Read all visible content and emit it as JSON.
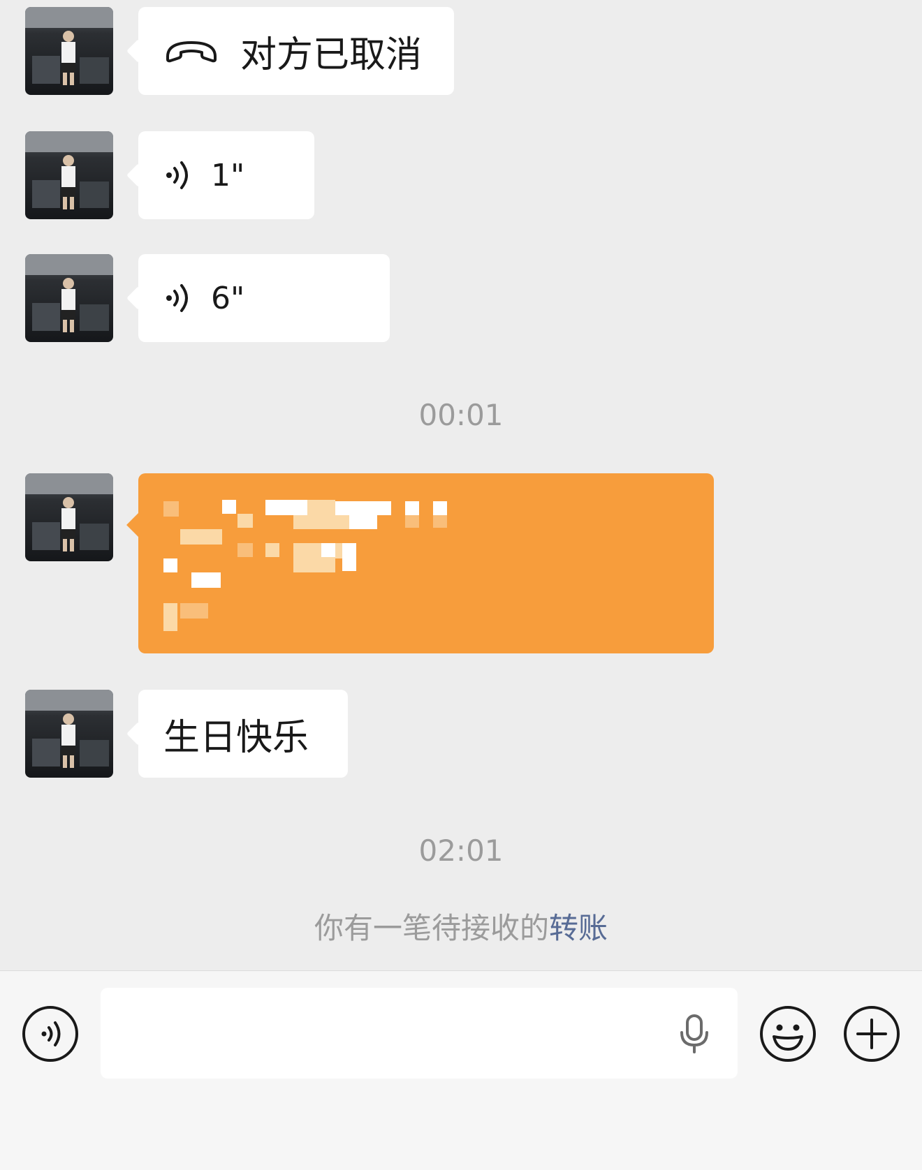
{
  "messages": [
    {
      "type": "call",
      "text": "对方已取消"
    },
    {
      "type": "voice",
      "duration": "1\""
    },
    {
      "type": "voice",
      "duration": "6\""
    },
    {
      "type": "text",
      "text": "生日快乐"
    }
  ],
  "timestamps": [
    "00:01",
    "02:01"
  ],
  "system": {
    "prefix": "你有一笔待接收的",
    "link": "转账"
  },
  "colors": {
    "chat_bg": "#ededed",
    "bubble_bg": "#ffffff",
    "transfer_orange": "#f79d3c",
    "link_blue": "#576b95",
    "timestamp_gray": "#9b9b9b"
  },
  "icons": {
    "call": "phone-hangup-icon",
    "voice": "voice-wave-icon",
    "voice_toggle": "voice-mode-icon",
    "mic": "microphone-icon",
    "emoji": "emoji-icon",
    "plus": "plus-icon"
  }
}
